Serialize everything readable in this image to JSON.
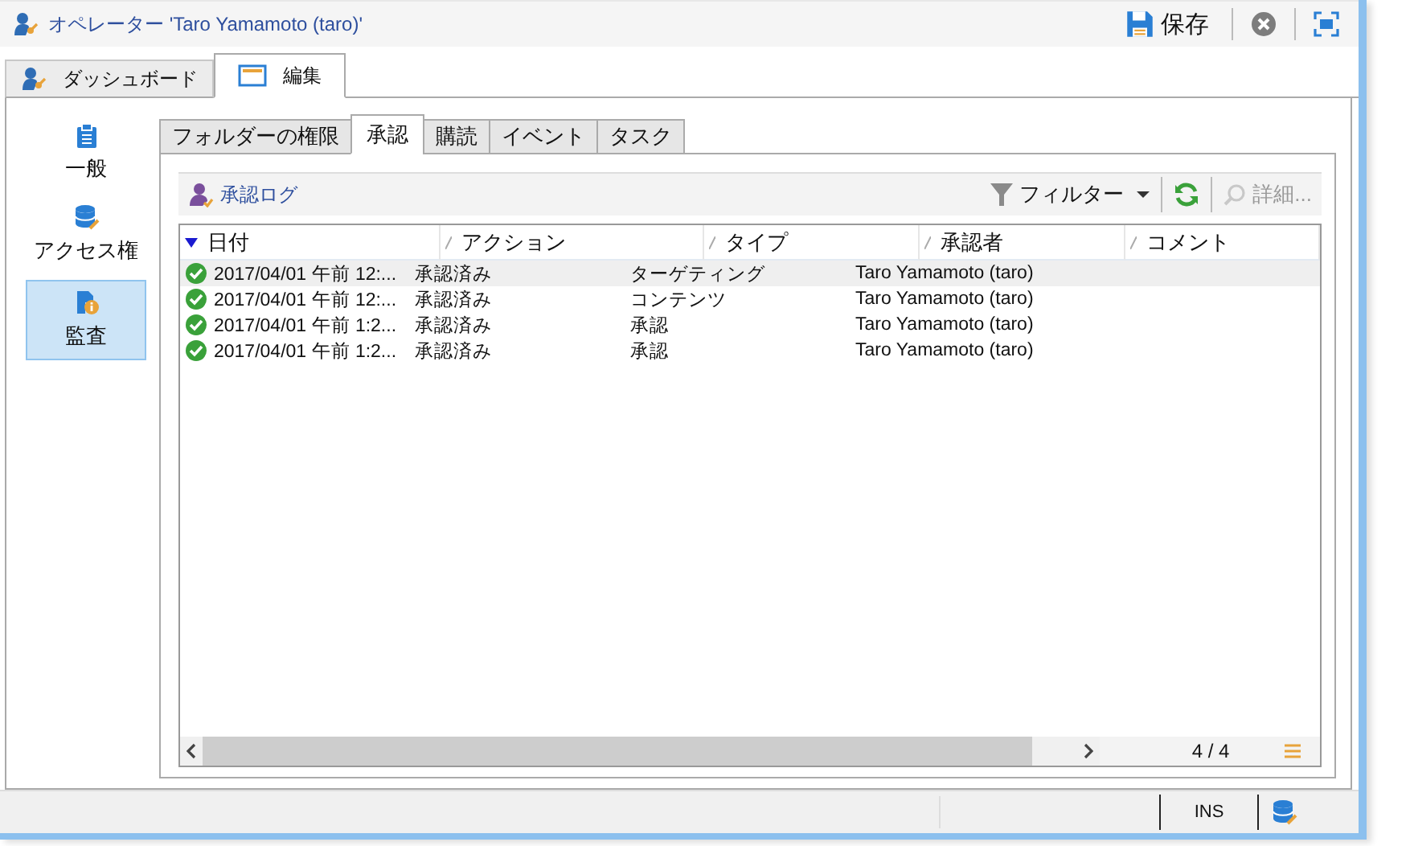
{
  "window": {
    "title": "オペレーター 'Taro Yamamoto (taro)'"
  },
  "toolbar": {
    "save": "保存"
  },
  "tabs": [
    {
      "label": "ダッシュボード",
      "selected": false
    },
    {
      "label": "編集",
      "selected": true
    }
  ],
  "sidebar": {
    "items": [
      {
        "label": "一般",
        "selected": false
      },
      {
        "label": "アクセス権",
        "selected": false
      },
      {
        "label": "監査",
        "selected": true
      }
    ]
  },
  "subtabs": [
    {
      "label": "フォルダーの権限",
      "selected": false
    },
    {
      "label": "承認",
      "selected": true
    },
    {
      "label": "購読",
      "selected": false
    },
    {
      "label": "イベント",
      "selected": false
    },
    {
      "label": "タスク",
      "selected": false
    }
  ],
  "log": {
    "title": "承認ログ",
    "filter": "フィルター",
    "details": "詳細..."
  },
  "table": {
    "columns": [
      {
        "label": "日付",
        "sorted": true
      },
      {
        "label": "アクション",
        "sorted": false
      },
      {
        "label": "タイプ",
        "sorted": false
      },
      {
        "label": "承認者",
        "sorted": false
      },
      {
        "label": "コメント",
        "sorted": false
      }
    ],
    "rows": [
      {
        "date": "2017/04/01 午前 12:...",
        "action": "承認済み",
        "type": "ターゲティング",
        "approver": "Taro Yamamoto (taro)",
        "selected": true
      },
      {
        "date": "2017/04/01 午前 12:...",
        "action": "承認済み",
        "type": "コンテンツ",
        "approver": "Taro Yamamoto (taro)",
        "selected": false
      },
      {
        "date": "2017/04/01 午前 1:2...",
        "action": "承認済み",
        "type": "承認",
        "approver": "Taro Yamamoto (taro)",
        "selected": false
      },
      {
        "date": "2017/04/01 午前 1:2...",
        "action": "承認済み",
        "type": "承認",
        "approver": "Taro Yamamoto (taro)",
        "selected": false
      }
    ],
    "count": "4 / 4"
  },
  "status_bar": {
    "mode": "INS"
  }
}
